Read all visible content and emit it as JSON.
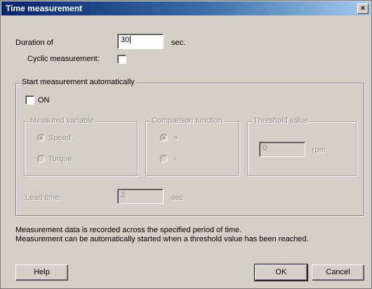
{
  "window": {
    "title": "Time measurement",
    "close_label": "×"
  },
  "duration": {
    "label": "Duration of",
    "value": "30",
    "unit": "sec."
  },
  "cyclic": {
    "label": "Cyclic measurement:",
    "checked": false
  },
  "auto_start": {
    "group_label": "Start measurement automatically",
    "on_label": "ON",
    "on_checked": false,
    "measured_variable": {
      "label": "Measured variable",
      "options": [
        "Speed",
        "Torque"
      ],
      "selected": "Speed"
    },
    "comparison_function": {
      "label": "Comparison function",
      "options": [
        ">",
        "<"
      ],
      "selected": ">"
    },
    "threshold": {
      "label": "Threshold value",
      "value": "0",
      "unit": "rpm"
    },
    "lead_time": {
      "label": "Lead time:",
      "value": "2",
      "unit": "sec."
    }
  },
  "info": {
    "line1": "Measurement data is recorded across the specified period of time.",
    "line2": "Measurement can be automatically started when a threshold value has been reached."
  },
  "buttons": {
    "help": "Help",
    "ok": "OK",
    "cancel": "Cancel"
  }
}
